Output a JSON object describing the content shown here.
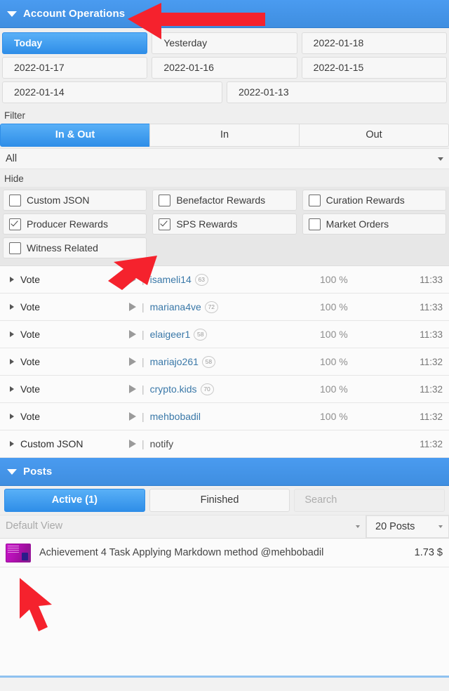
{
  "account_operations": {
    "title": "Account Operations",
    "caret_icon": "caret-down-icon",
    "date_tabs": [
      {
        "label": "Today",
        "active": true
      },
      {
        "label": "Yesterday",
        "active": false
      },
      {
        "label": "2022-01-18",
        "active": false
      },
      {
        "label": "2022-01-17",
        "active": false
      },
      {
        "label": "2022-01-16",
        "active": false
      },
      {
        "label": "2022-01-15",
        "active": false
      },
      {
        "label": "2022-01-14",
        "active": false
      },
      {
        "label": "2022-01-13",
        "active": false
      }
    ],
    "filter": {
      "label": "Filter",
      "segments": [
        {
          "label": "In & Out",
          "active": true
        },
        {
          "label": "In",
          "active": false
        },
        {
          "label": "Out",
          "active": false
        }
      ],
      "select_value": "All",
      "select_arrow_icon": "chevron-down-icon"
    },
    "hide": {
      "label": "Hide",
      "items": [
        {
          "label": "Custom JSON",
          "checked": false
        },
        {
          "label": "Benefactor Rewards",
          "checked": false
        },
        {
          "label": "Curation Rewards",
          "checked": false
        },
        {
          "label": "Producer Rewards",
          "checked": true
        },
        {
          "label": "SPS Rewards",
          "checked": true
        },
        {
          "label": "Market Orders",
          "checked": false
        },
        {
          "label": "Witness Related",
          "checked": false
        }
      ]
    },
    "operations": [
      {
        "type": "Vote",
        "account": "isameli14",
        "reputation": "63",
        "percent": "100 %",
        "time": "11:33"
      },
      {
        "type": "Vote",
        "account": "mariana4ve",
        "reputation": "72",
        "percent": "100 %",
        "time": "11:33"
      },
      {
        "type": "Vote",
        "account": "elaigeer1",
        "reputation": "58",
        "percent": "100 %",
        "time": "11:33"
      },
      {
        "type": "Vote",
        "account": "mariajo261",
        "reputation": "58",
        "percent": "100 %",
        "time": "11:32"
      },
      {
        "type": "Vote",
        "account": "crypto.kids",
        "reputation": "70",
        "percent": "100 %",
        "time": "11:32"
      },
      {
        "type": "Vote",
        "account": "mehbobadil",
        "reputation": "",
        "percent": "100 %",
        "time": "11:32"
      },
      {
        "type": "Custom JSON",
        "account": "notify",
        "reputation": "",
        "percent": "",
        "time": "11:32"
      }
    ]
  },
  "posts": {
    "title": "Posts",
    "caret_icon": "caret-down-icon",
    "tabs": [
      {
        "label": "Active (1)",
        "active": true
      },
      {
        "label": "Finished",
        "active": false
      }
    ],
    "search_placeholder": "Search",
    "view_select": "Default View",
    "count_select": "20 Posts",
    "items": [
      {
        "thumbnail": "post-thumbnail-image",
        "title": "Achievement 4 Task Applying Markdown method @mehbobadil",
        "amount": "1.73 $"
      }
    ]
  },
  "colors": {
    "accent_blue": "#3f8ee0",
    "annotation_red": "#f5222d",
    "link_blue": "#3a78a8"
  }
}
